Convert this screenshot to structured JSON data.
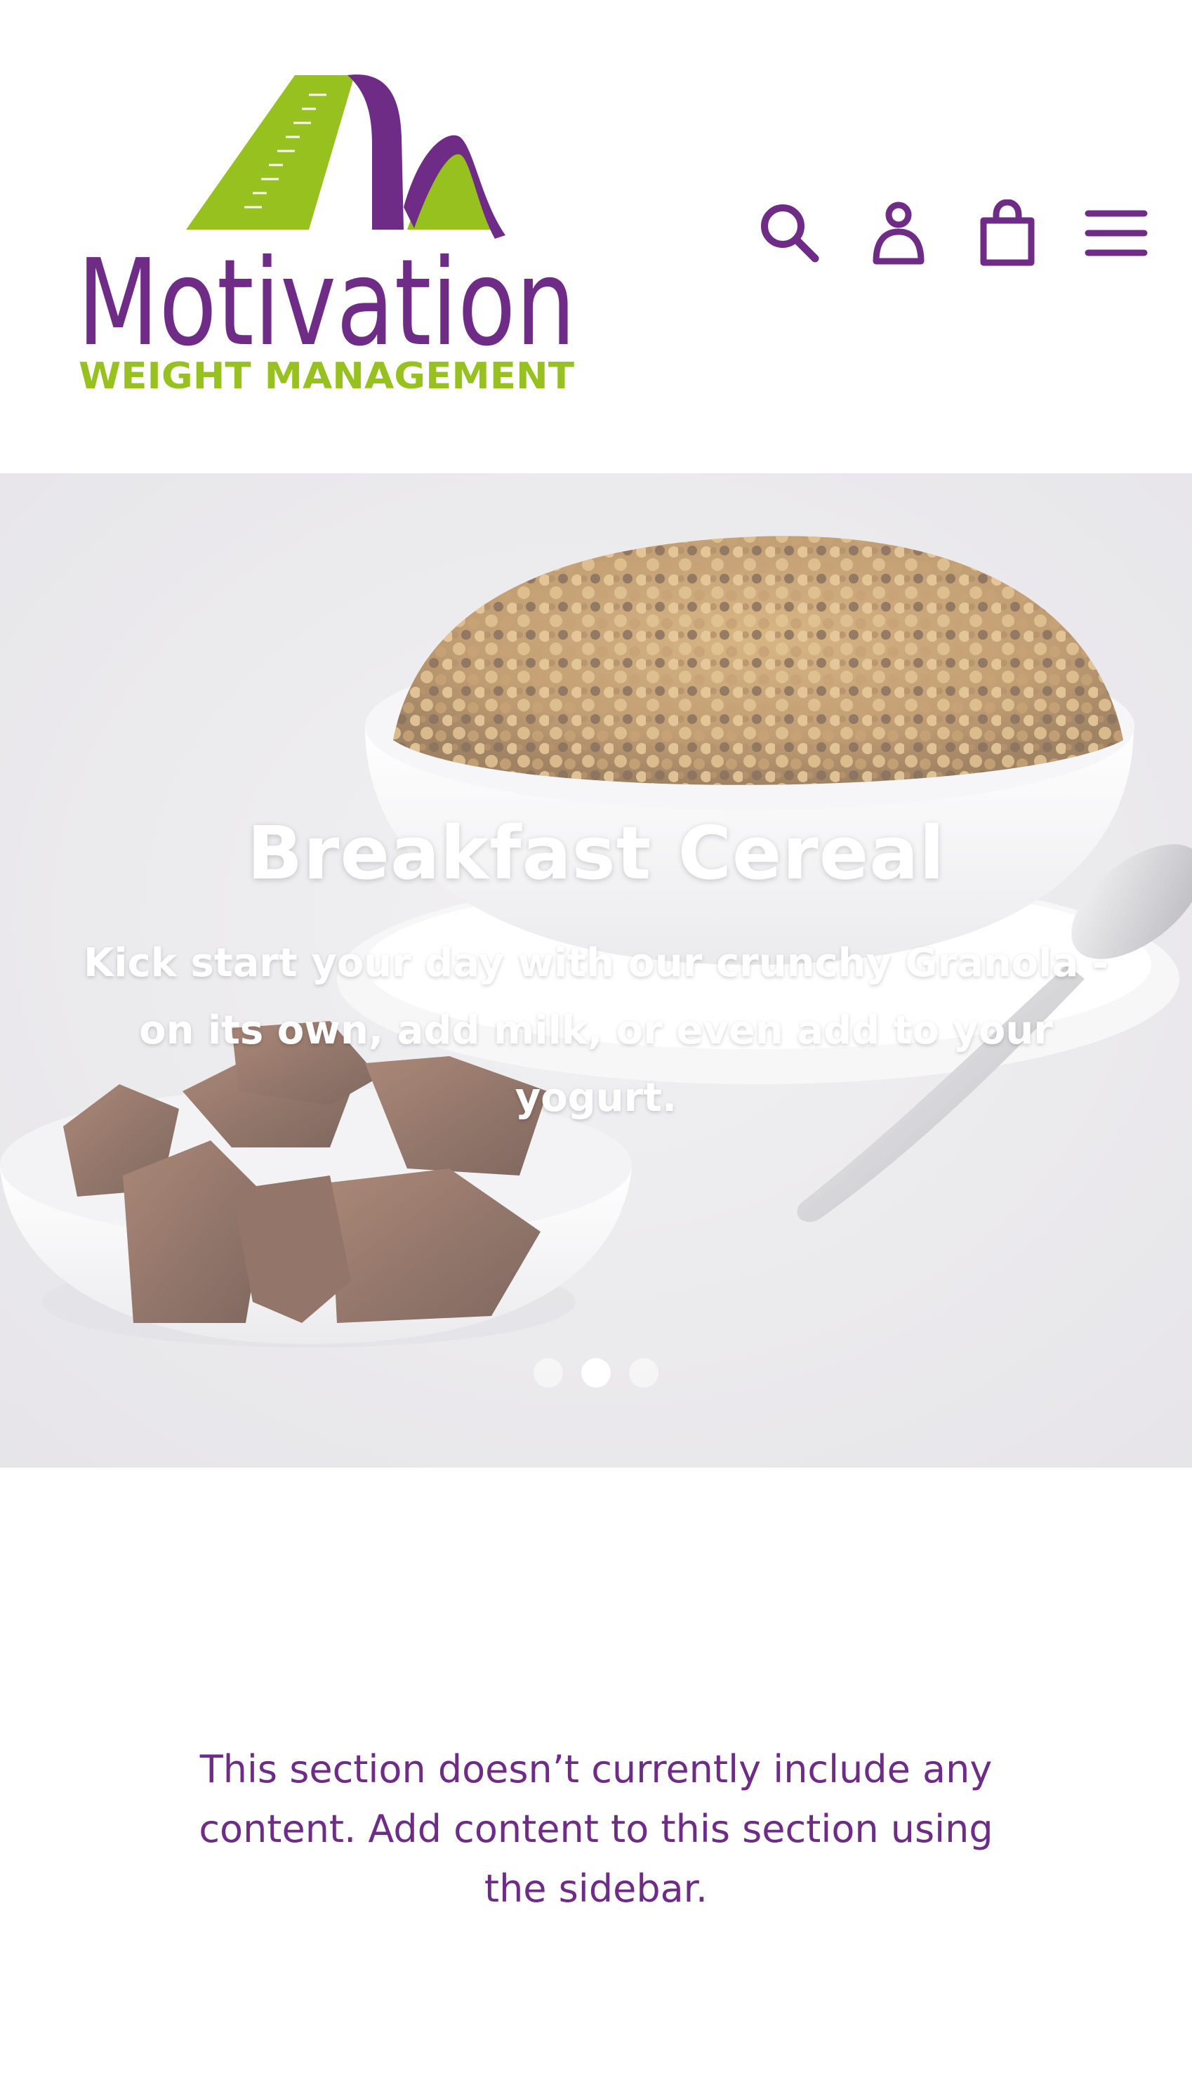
{
  "brand": {
    "logo_name": "Motivation",
    "logo_tagline": "WEIGHT MANAGEMENT",
    "primary_color": "#6e2c86",
    "accent_color": "#97c11f"
  },
  "header": {
    "icons": [
      "search-icon",
      "account-icon",
      "cart-icon",
      "menu-icon"
    ]
  },
  "hero": {
    "title": "Breakfast Cereal",
    "subtitle": "Kick start your day with our crunchy Granola - on its own, add milk, or even add to your yogurt.",
    "slides_count": 3,
    "active_slide": 2
  },
  "empty_section": {
    "message": "This section doesn’t currently include any content. Add content to this section using the sidebar."
  }
}
